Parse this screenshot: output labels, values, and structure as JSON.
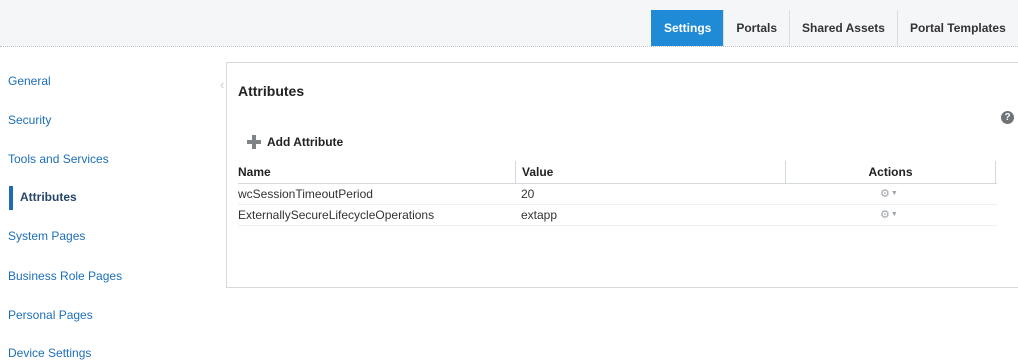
{
  "tabs": [
    {
      "label": "Settings",
      "active": true
    },
    {
      "label": "Portals",
      "active": false
    },
    {
      "label": "Shared Assets",
      "active": false
    },
    {
      "label": "Portal Templates",
      "active": false
    }
  ],
  "sidebar": {
    "items": [
      {
        "label": "General"
      },
      {
        "label": "Security"
      },
      {
        "label": "Tools and Services"
      },
      {
        "label": "Attributes",
        "active": true
      },
      {
        "label": "System Pages"
      },
      {
        "label": "Business Role Pages"
      },
      {
        "label": "Personal Pages"
      },
      {
        "label": "Device Settings"
      }
    ]
  },
  "main": {
    "title": "Attributes",
    "help_icon": "?",
    "add_label": "Add Attribute",
    "columns": {
      "name": "Name",
      "value": "Value",
      "actions": "Actions"
    },
    "rows": [
      {
        "name": "wcSessionTimeoutPeriod",
        "value": "20"
      },
      {
        "name": "ExternallySecureLifecycleOperations",
        "value": "extapp"
      }
    ]
  },
  "colors": {
    "active_tab": "#1f8ad6",
    "link": "#1d6fb8",
    "active_nav": "#27466a"
  }
}
